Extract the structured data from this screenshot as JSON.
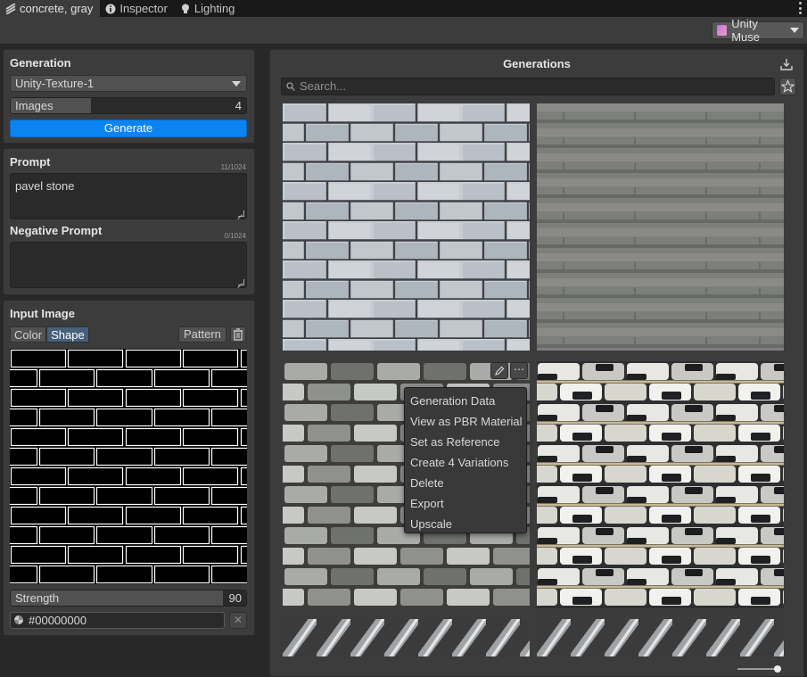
{
  "tabs": [
    {
      "label": "concrete, gray",
      "icon": "material-icon",
      "active": true
    },
    {
      "label": "Inspector",
      "icon": "info-icon",
      "active": false
    },
    {
      "label": "Lighting",
      "icon": "bulb-icon",
      "active": false
    }
  ],
  "toolbar": {
    "account_label": "Unity Muse",
    "account_icon": "muse-logo-icon"
  },
  "generation": {
    "title": "Generation",
    "model": "Unity-Texture-1",
    "images_label": "Images",
    "images_value": "4",
    "images_fraction": 0.34,
    "generate_label": "Generate"
  },
  "prompt": {
    "title": "Prompt",
    "counter": "11/1024",
    "value": "pavel stone",
    "negative_title": "Negative Prompt",
    "negative_counter": "0/1024",
    "negative_value": ""
  },
  "input_image": {
    "title": "Input Image",
    "modes": [
      "Color",
      "Shape"
    ],
    "selected_mode": "Shape",
    "pattern_label": "Pattern",
    "strength_label": "Strength",
    "strength_value": "90",
    "strength_fraction": 0.9,
    "color_value": "#00000000"
  },
  "generations": {
    "title": "Generations",
    "search_placeholder": "Search...",
    "tiles": [
      "light-gray-brick-texture",
      "gray-horizontal-stone-texture",
      "mixed-gray-brick-texture",
      "black-white-stone-texture",
      "diagonal-metal-texture",
      "diagonal-metal-texture"
    ],
    "tile_actions": [
      "edit-icon",
      "more-icon"
    ],
    "context_menu": [
      "Generation Data",
      "View as PBR Material",
      "Set as Reference",
      "Create 4 Variations",
      "Delete",
      "Export",
      "Upscale"
    ],
    "zoom_fraction": 0.95
  },
  "colors": {
    "accent": "#0b84f2",
    "panel": "#3c3c3c",
    "background": "#282828",
    "selected_mode": "#46607c"
  }
}
